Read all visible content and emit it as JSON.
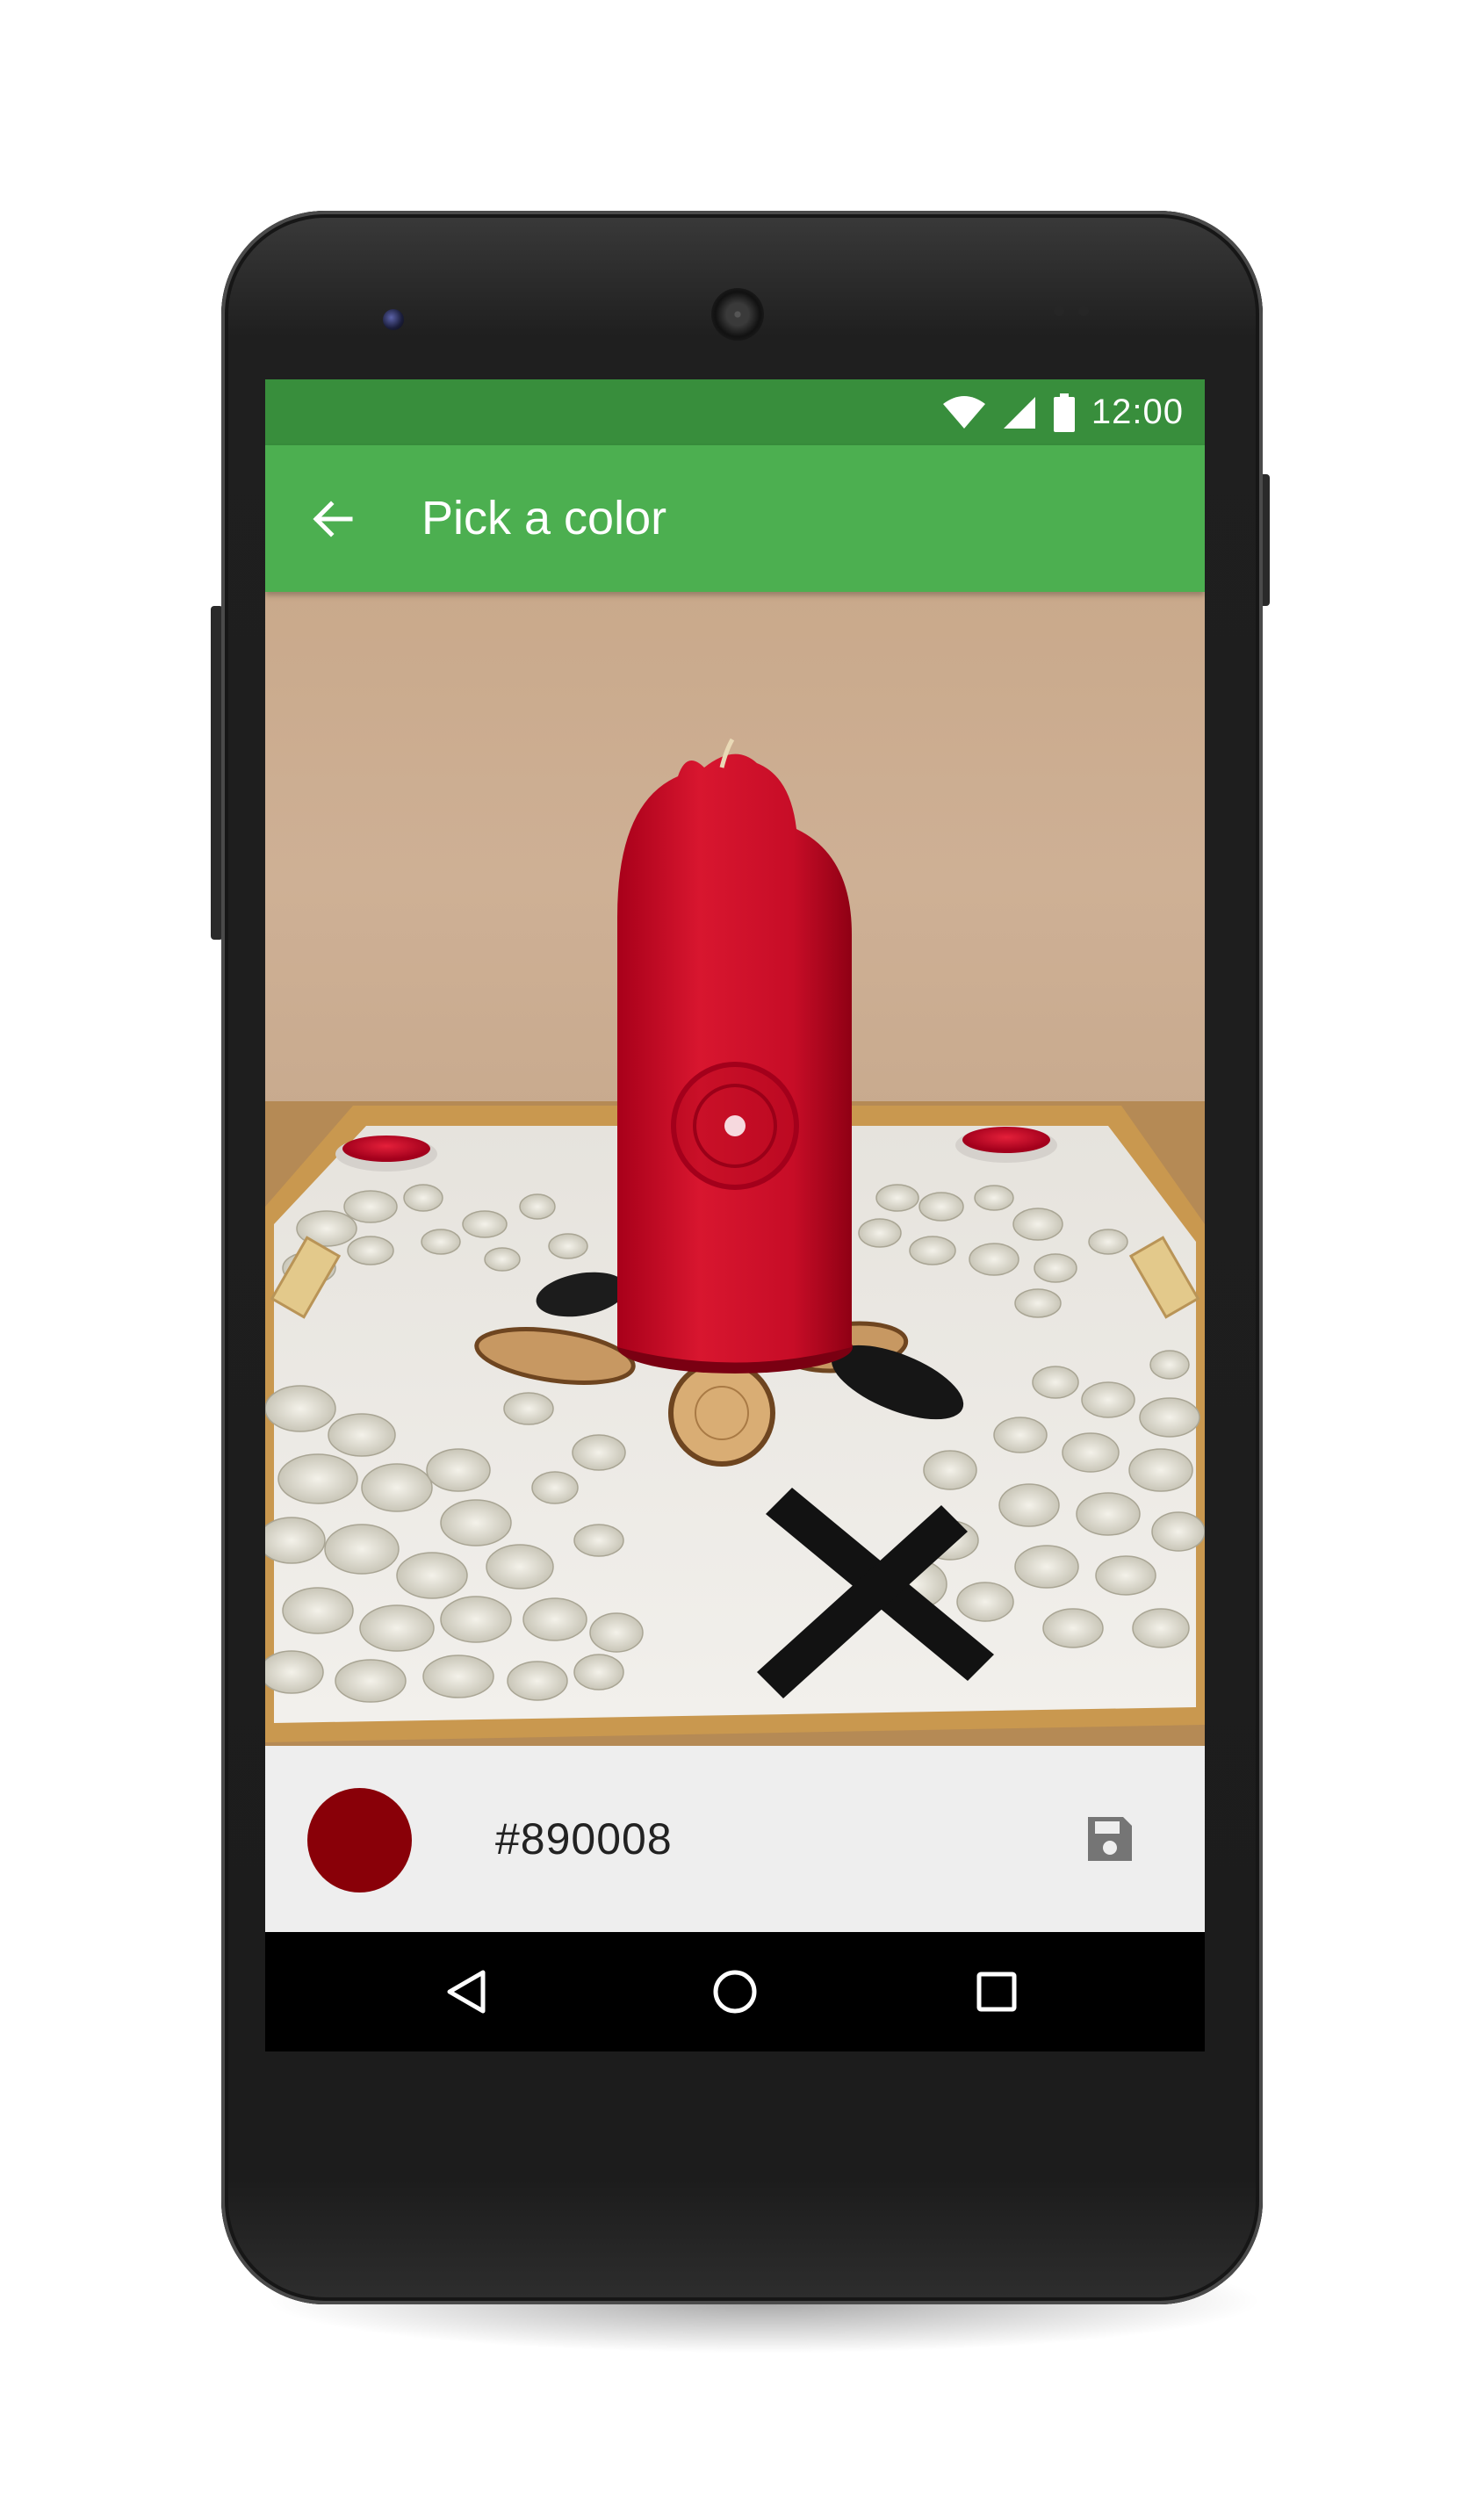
{
  "status_bar": {
    "time": "12:00",
    "icons": [
      "wifi-icon",
      "signal-icon",
      "battery-icon"
    ]
  },
  "app_bar": {
    "title": "Pick a color",
    "back_icon": "arrow-back-icon"
  },
  "photo": {
    "description_icon": "camera-photo",
    "picker_target": "crosshair-target"
  },
  "color_result": {
    "hex": "#890008",
    "swatch_color": "#890008",
    "save_icon": "save-icon"
  },
  "nav_bar": {
    "buttons": [
      "back-triangle-icon",
      "home-circle-icon",
      "recents-square-icon"
    ]
  },
  "colors": {
    "status_bar": "#388E3C",
    "app_bar": "#4CAF50",
    "panel": "#EEEEEE"
  }
}
